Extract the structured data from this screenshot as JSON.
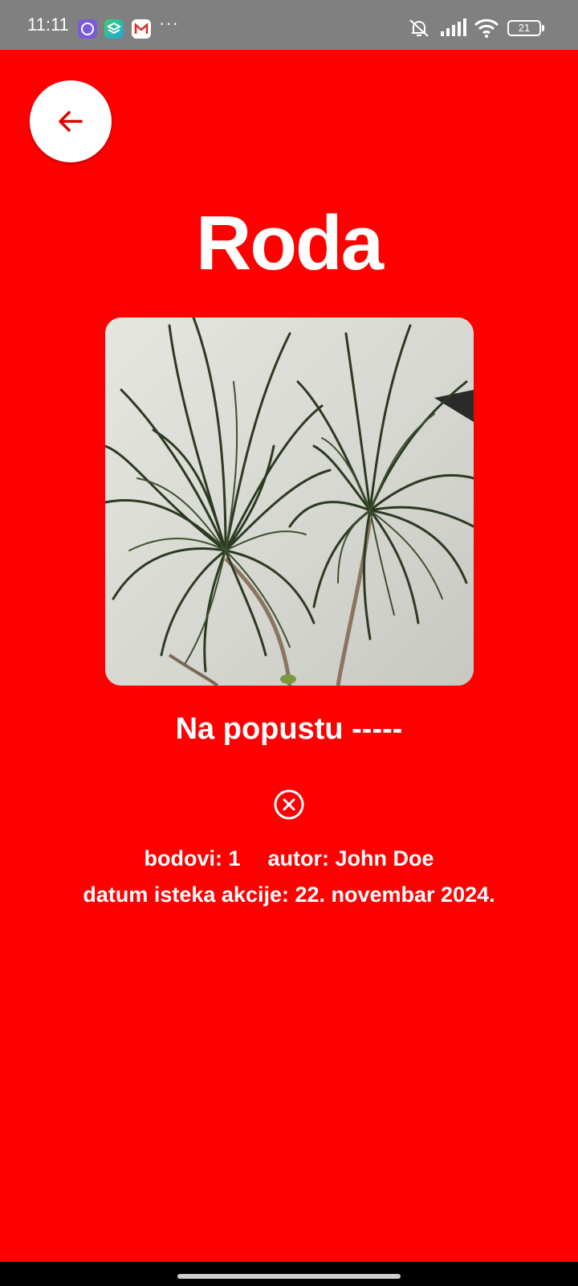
{
  "status_bar": {
    "time": "11:11",
    "more": "···",
    "battery_level": "21",
    "icons": [
      "viber-icon",
      "layers-app-icon",
      "gmail-icon",
      "mute-icon",
      "signal-icon",
      "wifi-icon",
      "battery-icon"
    ]
  },
  "header": {
    "back_icon": "arrow-left-icon"
  },
  "product": {
    "title": "Roda",
    "promo_text": "Na popustu -----",
    "points_label": "bodovi: 1",
    "author_label": "autor: John Doe",
    "expiry_label": "datum isteka akcije: 22. novembar 2024."
  },
  "colors": {
    "background": "#ff0000",
    "accent": "#e00000",
    "text": "#ffffff",
    "status_bar": "#808080"
  }
}
